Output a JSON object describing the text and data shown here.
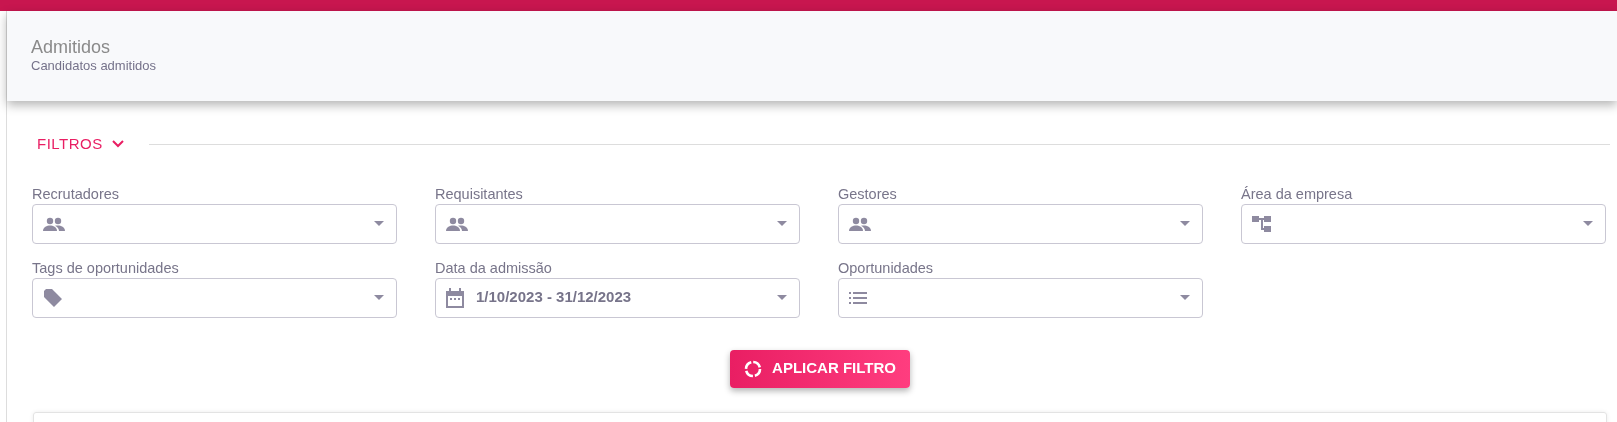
{
  "header": {
    "title": "Admitidos",
    "subtitle": "Candidatos admitidos"
  },
  "filters": {
    "label": "FILTROS",
    "expanded": true,
    "fields": [
      {
        "label": "Recrutadores",
        "kind": "people"
      },
      {
        "label": "Requisitantes",
        "kind": "people"
      },
      {
        "label": "Gestores",
        "kind": "people"
      },
      {
        "label": "Área da empresa",
        "kind": "tree"
      },
      {
        "label": "Tags de oportunidades",
        "kind": "tag"
      },
      {
        "label": "Data da admissão",
        "kind": "date",
        "value": "1/10/2023 - 31/12/2023"
      },
      {
        "label": "Oportunidades",
        "kind": "list"
      }
    ]
  },
  "apply_button": {
    "label": "APLICAR FILTRO"
  }
}
